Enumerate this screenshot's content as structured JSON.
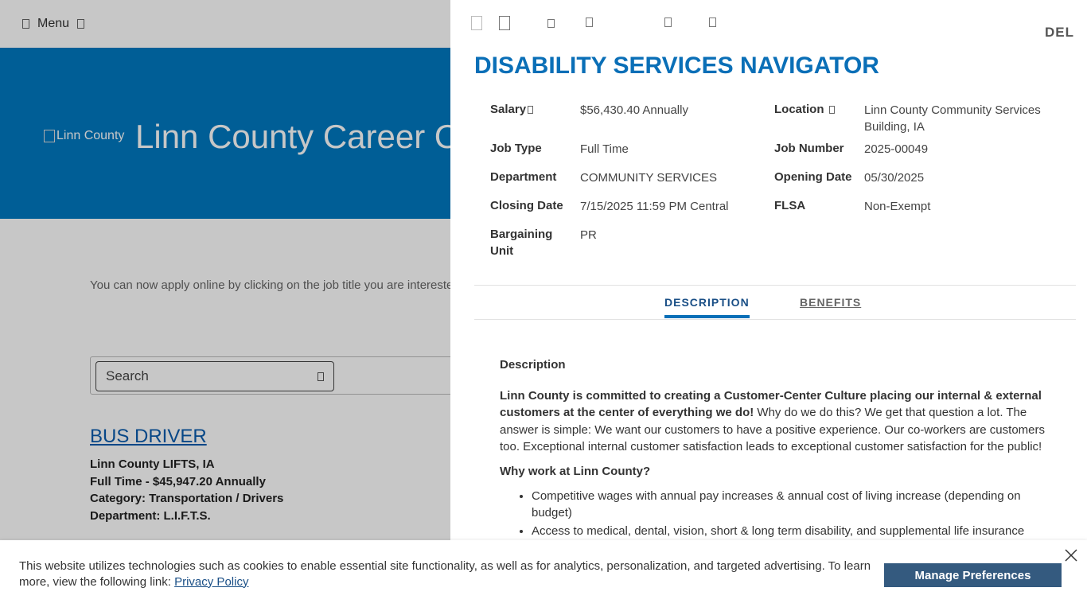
{
  "background": {
    "menu_label": "Menu",
    "hero_logo_alt": "Linn County",
    "hero_title": "Linn County Career O",
    "intro_text": "You can now apply online by clicking on the job title you are intereste",
    "search_placeholder": "Search",
    "job": {
      "title": "BUS DRIVER",
      "location": "Linn County LIFTS, IA",
      "type_salary": "Full Time - $45,947.20 Annually",
      "category": "Category: Transportation / Drivers",
      "department": "Department: L.I.F.T.S."
    }
  },
  "drawer": {
    "del_label": "DEL",
    "job_title": "DISABILITY SERVICES NAVIGATOR",
    "fields": {
      "salary_label": "Salary",
      "salary_value": "$56,430.40 Annually",
      "location_label": "Location",
      "location_value": "Linn County Community Services Building, IA",
      "job_type_label": "Job Type",
      "job_type_value": "Full Time",
      "job_number_label": "Job Number",
      "job_number_value": "2025-00049",
      "department_label": "Department",
      "department_value": "COMMUNITY SERVICES",
      "opening_date_label": "Opening Date",
      "opening_date_value": "05/30/2025",
      "closing_date_label": "Closing Date",
      "closing_date_value": "7/15/2025 11:59 PM Central",
      "flsa_label": "FLSA",
      "flsa_value": "Non-Exempt",
      "bargaining_label_1": "Bargaining",
      "bargaining_label_2": "Unit",
      "bargaining_value": "PR"
    },
    "tabs": {
      "description": "DESCRIPTION",
      "benefits": "BENEFITS"
    },
    "description": {
      "heading": "Description",
      "intro_bold": "Linn County is committed to creating a Customer-Center Culture placing our internal & external customers at the center of everything we do!",
      "intro_rest": " Why do we do this? We get that question a lot. The answer is simple: We want our customers to have a positive experience. Our co-workers are customers too. Exceptional internal customer satisfaction leads to exceptional customer satisfaction for the public!",
      "why_heading": "Why work at Linn County?",
      "bullets": [
        "Competitive wages with annual pay increases & annual cost of living increase (depending on budget)",
        "Access to medical, dental, vision, short & long term disability, and supplemental life insurance"
      ]
    }
  },
  "cookie": {
    "text": "This website utilizes technologies such as cookies to enable essential site functionality, as well as for analytics, personalization, and targeted advertising. To learn more, view the following link: ",
    "link_text": "Privacy Policy",
    "button": "Manage Preferences"
  }
}
